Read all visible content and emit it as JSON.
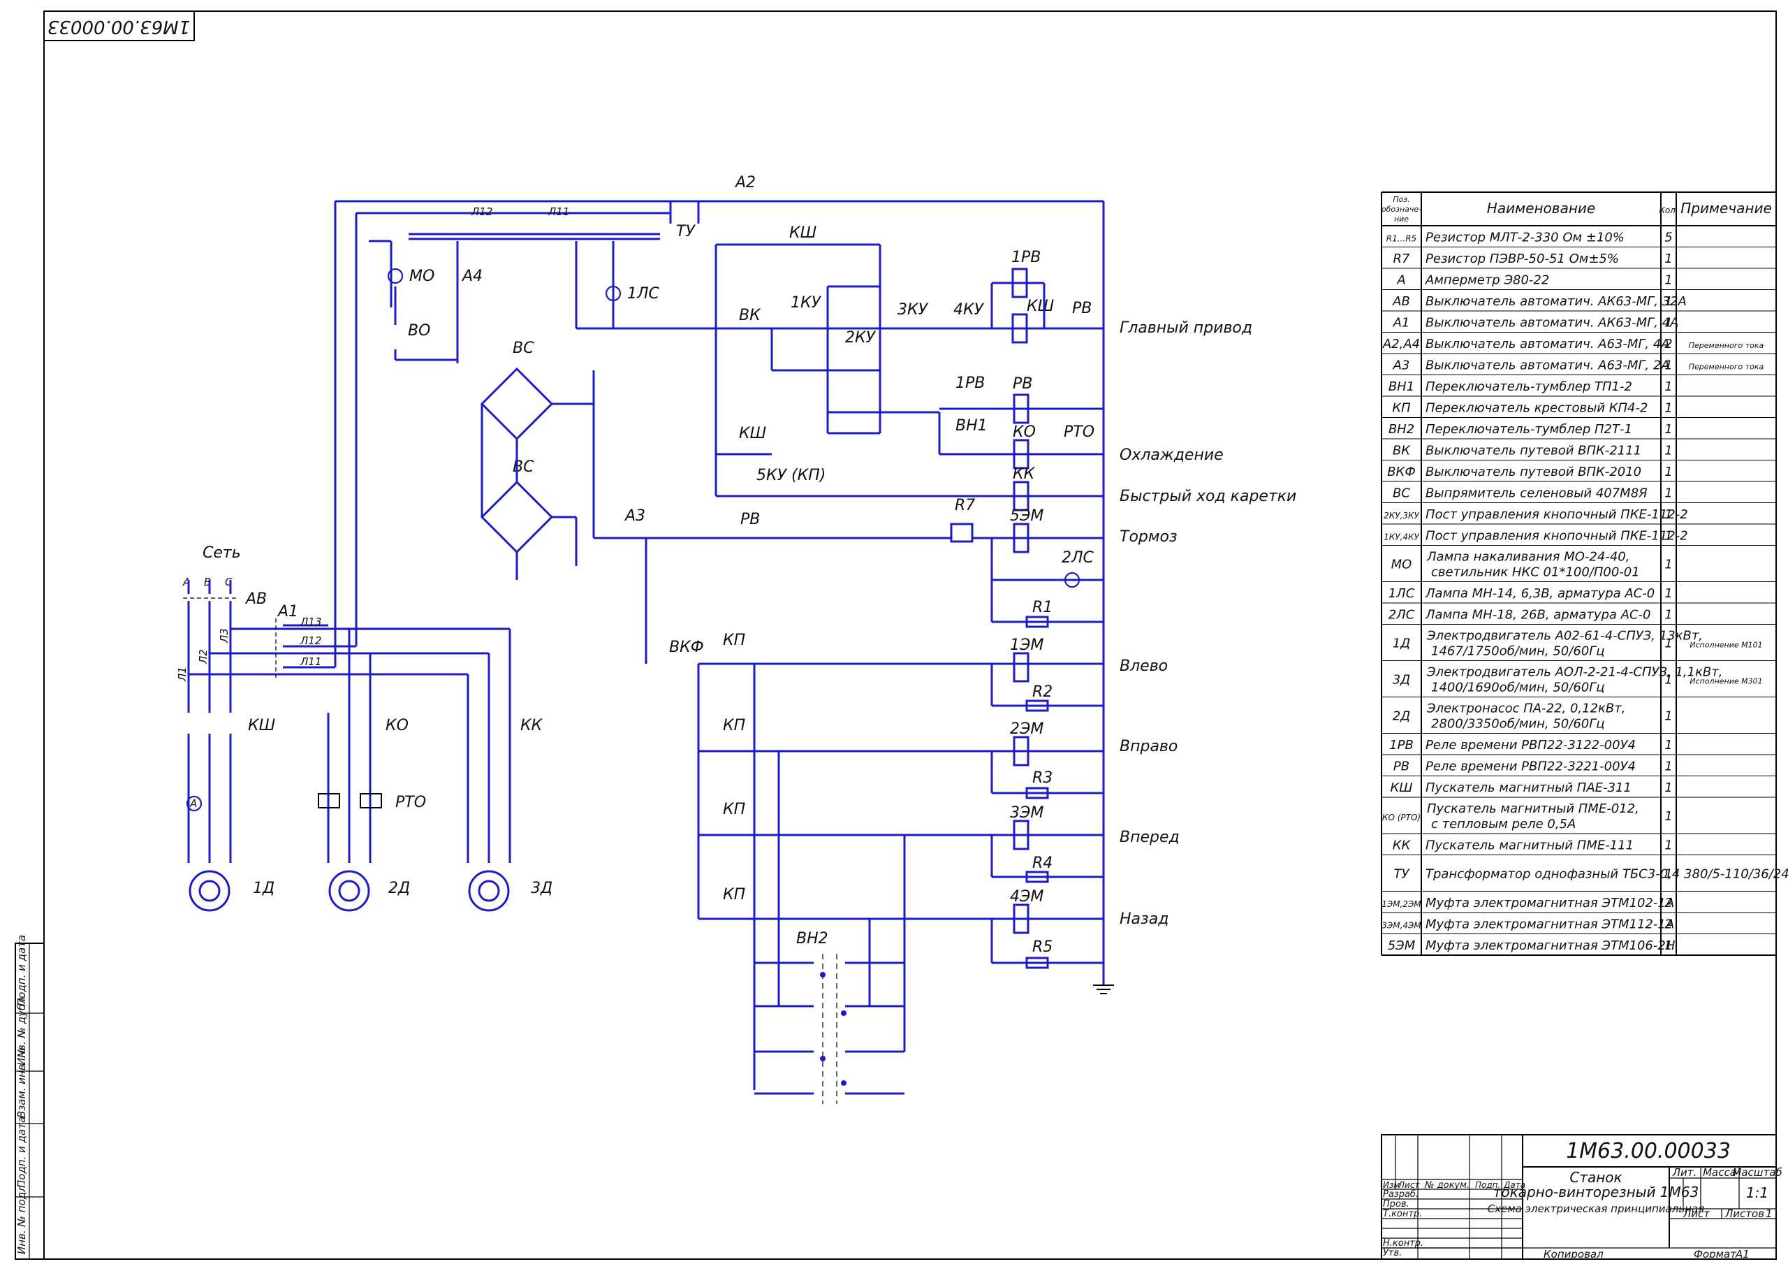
{
  "drawing": {
    "code": "1М63.00.00033",
    "code_rotated": "1М63.00.00033",
    "machine_name_1": "Станок",
    "machine_name_2": "токарно-винторезный 1М63",
    "doc_name": "Схема электрическая принципиальная",
    "scale": "1:1",
    "sheet_label": "Лист",
    "sheets_label": "Листов",
    "sheets_count": "1",
    "lit_label": "Лит.",
    "mass_label": "Масса",
    "scale_label": "Масштаб",
    "copied_label": "Копировал",
    "format_label": "Формат",
    "format": "А1"
  },
  "title_block": {
    "cols": [
      "Изм",
      "Лист",
      "№ докум.",
      "Подп.",
      "Дата"
    ],
    "rows": [
      "Разраб.",
      "Пров.",
      "Т.контр.",
      "",
      "Н.контр.",
      "Утв."
    ]
  },
  "side_stamp": [
    "Инв. № подл.",
    "Подп. и дата",
    "Взам. инв. №",
    "Инв. № дубл.",
    "Подп. и дата"
  ],
  "circuit_labels": {
    "mains": "Сеть",
    "phases": [
      "А",
      "В",
      "С"
    ],
    "main_switch": "АВ",
    "breaker_a1": "А1",
    "breaker_a2": "А2",
    "breaker_a3": "А3",
    "breaker_a4": "А4",
    "transformer": "ТУ",
    "rectifier": "ВС",
    "lamp_mo": "МО",
    "lamp_1ls": "1ЛС",
    "lamp_2ls": "2ЛС",
    "switch_vo": "ВО",
    "motors": [
      "1Д",
      "2Д",
      "3Д"
    ],
    "ammeter": "А",
    "contactors": [
      "КШ",
      "КО",
      "КК"
    ],
    "thermal_relay": "РТО",
    "resistor_r7": "R7",
    "resistors": [
      "R1",
      "R2",
      "R3",
      "R4",
      "R5"
    ],
    "couplings": [
      "5ЭМ",
      "1ЭМ",
      "2ЭМ",
      "3ЭМ",
      "4ЭМ"
    ],
    "relays": [
      "1РВ",
      "РВ",
      "КО",
      "КК",
      "КШ"
    ],
    "buttons": [
      "1КУ",
      "2КУ",
      "3КУ",
      "4КУ",
      "5КУ (КП)"
    ],
    "limit_switches": [
      "ВК",
      "ВКФ"
    ],
    "toggle": "ВН1",
    "toggle2": "ВН2",
    "cross_switch": "КП",
    "rv": "РВ",
    "line_names": [
      "Л1",
      "Л2",
      "Л3",
      "Л11",
      "Л12",
      "Л13"
    ]
  },
  "circuit_functions": [
    "Главный привод",
    "Охлаждение",
    "Быстрый ход каретки",
    "Тормоз",
    "Влево",
    "Вправо",
    "Вперед",
    "Назад"
  ],
  "spec_table": {
    "headers": [
      "Поз. обозначе- ние",
      "Наименование",
      "Кол.",
      "Примечание"
    ],
    "rows": [
      [
        "R1...R5",
        "Резистор МЛТ-2-330 Ом ±10%",
        "5",
        ""
      ],
      [
        "R7",
        "Резистор ПЭВР-50-51 Ом±5%",
        "1",
        ""
      ],
      [
        "А",
        "Амперметр Э80-22",
        "1",
        ""
      ],
      [
        "АВ",
        "Выключатель автоматич. АК63-МГ, 32А",
        "1",
        ""
      ],
      [
        "А1",
        "Выключатель автоматич. АК63-МГ, 4А",
        "1",
        ""
      ],
      [
        "А2,А4",
        "Выключатель автоматич. А63-МГ, 4А",
        "2",
        "Переменного тока"
      ],
      [
        "А3",
        "Выключатель автоматич. А63-МГ, 2А",
        "1",
        "Переменного тока"
      ],
      [
        "ВН1",
        "Переключатель-тумблер ТП1-2",
        "1",
        ""
      ],
      [
        "КП",
        "Переключатель крестовый КП4-2",
        "1",
        ""
      ],
      [
        "ВН2",
        "Переключатель-тумблер П2Т-1",
        "1",
        ""
      ],
      [
        "ВК",
        "Выключатель путевой ВПК-2111",
        "1",
        ""
      ],
      [
        "ВКФ",
        "Выключатель путевой ВПК-2010",
        "1",
        ""
      ],
      [
        "ВС",
        "Выпрямитель селеновый 407М8Я",
        "1",
        ""
      ],
      [
        "2КУ,3КУ",
        "Пост управления кнопочный ПКЕ-112-2",
        "1",
        ""
      ],
      [
        "1КУ,4КУ",
        "Пост управления кнопочный ПКЕ-112-2",
        "1",
        ""
      ],
      [
        "МО",
        "Лампа накаливания МО-24-40, светильник НКС 01*100/П00-01",
        "1",
        ""
      ],
      [
        "1ЛС",
        "Лампа МН-14, 6,3В, арматура АС-0",
        "1",
        ""
      ],
      [
        "2ЛС",
        "Лампа МН-18, 26В, арматура АС-0",
        "1",
        ""
      ],
      [
        "1Д",
        "Электродвигатель А02-61-4-СПУЗ, 13кВт, 1467/1750об/мин, 50/60Гц",
        "1",
        "Исполнение М101"
      ],
      [
        "3Д",
        "Электродвигатель АОЛ-2-21-4-СПУЗ, 1,1кВт, 1400/1690об/мин, 50/60Гц",
        "1",
        "Исполнение М301"
      ],
      [
        "2Д",
        "Электронасос ПА-22, 0,12кВт, 2800/3350об/мин, 50/60Гц",
        "1",
        ""
      ],
      [
        "1РВ",
        "Реле времени РВП22-3122-00У4",
        "1",
        ""
      ],
      [
        "РВ",
        "Реле времени РВП22-3221-00У4",
        "1",
        ""
      ],
      [
        "КШ",
        "Пускатель магнитный ПАЕ-311",
        "1",
        ""
      ],
      [
        "КО (РТО)",
        "Пускатель магнитный ПМЕ-012, с тепловым реле 0,5А",
        "1",
        ""
      ],
      [
        "КК",
        "Пускатель магнитный ПМЕ-111",
        "1",
        ""
      ],
      [
        "ТУ",
        "Трансформатор однофазный ТБС3-0,4 380/5-110/36/24В",
        "1",
        ""
      ],
      [
        "1ЭМ,2ЭМ",
        "Муфта электромагнитная ЭТМ102-1А",
        "2",
        ""
      ],
      [
        "3ЭМ,4ЭМ",
        "Муфта электромагнитная ЭТМ112-1А",
        "2",
        ""
      ],
      [
        "5ЭМ",
        "Муфта электромагнитная ЭТМ106-2Н",
        "1",
        ""
      ]
    ]
  }
}
